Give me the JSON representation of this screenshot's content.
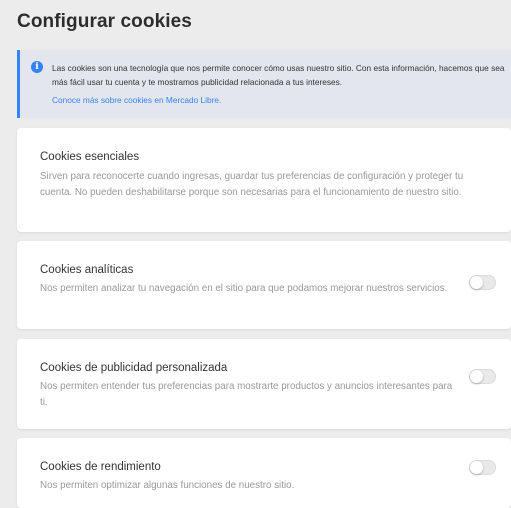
{
  "page": {
    "title": "Configurar cookies"
  },
  "info": {
    "text": "Las cookies son una tecnología que nos permite conocer cómo usas nuestro sitio. Con esta información, hacemos que sea más fácil usar tu cuenta y te mostramos publicidad relacionada a tus intereses.",
    "link": "Conoce más sobre cookies en Mercado Libre.",
    "icon": "info-icon",
    "accent_color": "#3483fa"
  },
  "cookies": [
    {
      "title": "Cookies esenciales",
      "description": "Sirven para reconocerte cuando ingresas, guardar tus preferencias de configuración y proteger tu cuenta. No pueden deshabilitarse porque son necesarias para el funcionamiento de nuestro sitio.",
      "toggle": null
    },
    {
      "title": "Cookies analíticas",
      "description": "Nos permiten analizar tu navegación en el sitio para que podamos mejorar nuestros servicios.",
      "toggle": "off"
    },
    {
      "title": "Cookies de publicidad personalizada",
      "description": "Nos permiten entender tus preferencias para mostrarte productos y anuncios interesantes para ti.",
      "toggle": "off"
    },
    {
      "title": "Cookies de rendimiento",
      "description": "Nos permiten optimizar algunas funciones de nuestro sitio.",
      "toggle": "off"
    }
  ]
}
